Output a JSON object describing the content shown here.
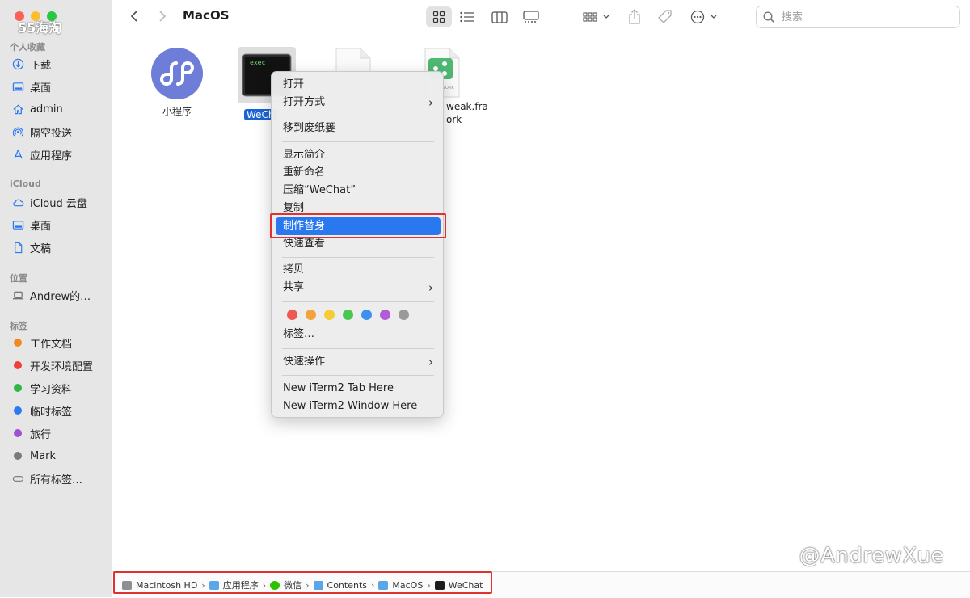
{
  "window": {
    "title": "MacOS"
  },
  "overlay": {
    "top_watermark": "55海淘",
    "bottom_watermark": "@AndrewXue"
  },
  "search": {
    "placeholder": "搜索",
    "value": ""
  },
  "sidebar": {
    "sections": [
      {
        "title": "个人收藏",
        "items": [
          {
            "label": "下载",
            "icon": "download-icon"
          },
          {
            "label": "桌面",
            "icon": "desktop-icon"
          },
          {
            "label": "admin",
            "icon": "home-icon"
          },
          {
            "label": "隔空投送",
            "icon": "airdrop-icon"
          },
          {
            "label": "应用程序",
            "icon": "applications-icon"
          }
        ]
      },
      {
        "title": "iCloud",
        "items": [
          {
            "label": "iCloud 云盘",
            "icon": "cloud-icon"
          },
          {
            "label": "桌面",
            "icon": "desktop-icon"
          },
          {
            "label": "文稿",
            "icon": "document-icon"
          }
        ]
      },
      {
        "title": "位置",
        "items": [
          {
            "label": "Andrew的…",
            "icon": "laptop-icon"
          }
        ]
      },
      {
        "title": "标签",
        "items": [
          {
            "label": "工作文档",
            "color": "#f08a1c"
          },
          {
            "label": "开发环境配置",
            "color": "#ee4038"
          },
          {
            "label": "学习资料",
            "color": "#2fb944"
          },
          {
            "label": "临时标签",
            "color": "#2a7bf0"
          },
          {
            "label": "旅行",
            "color": "#a24fd0"
          },
          {
            "label": "Mark",
            "color": "#7a7a7a"
          },
          {
            "label": "所有标签…",
            "icon": "all-tags-icon"
          }
        ]
      }
    ]
  },
  "files": [
    {
      "label": "小程序",
      "icon": "miniprogram-icon"
    },
    {
      "label": "WeCh",
      "icon": "terminal-exec-icon",
      "icon_text": "exec",
      "selected": true
    },
    {
      "label": "",
      "icon": "blank-file-icon"
    },
    {
      "label_line1": "weak.fra",
      "label_line2": "ork",
      "icon": "framework-icon",
      "icon_text": "WORK"
    }
  ],
  "context_menu": {
    "items": [
      {
        "label": "打开"
      },
      {
        "label": "打开方式",
        "submenu": true
      },
      {
        "label": "移到废纸篓"
      },
      {
        "label": "显示简介"
      },
      {
        "label": "重新命名"
      },
      {
        "label": "压缩“WeChat”"
      },
      {
        "label": "复制"
      },
      {
        "label": "制作替身",
        "highlighted": true
      },
      {
        "label": "快速查看"
      },
      {
        "label": "拷贝"
      },
      {
        "label": "共享",
        "submenu": true
      },
      {
        "label": "标签…"
      },
      {
        "label": "快速操作",
        "submenu": true
      },
      {
        "label": "New iTerm2 Tab Here"
      },
      {
        "label": "New iTerm2 Window Here"
      }
    ],
    "tag_colors": [
      "#ee5a52",
      "#f3a33b",
      "#f5cd33",
      "#4cc552",
      "#3f8ff0",
      "#b05ed8",
      "#9a9a9a"
    ],
    "submenu_glyph": "›"
  },
  "pathbar": {
    "crumbs": [
      {
        "label": "Macintosh HD",
        "icon": "disk-icon",
        "color": "#8e8e93"
      },
      {
        "label": "应用程序",
        "icon": "folder-icon",
        "color": "#5aa6e8"
      },
      {
        "label": "微信",
        "icon": "wechat-icon",
        "color": "#2dc100"
      },
      {
        "label": "Contents",
        "icon": "folder-icon",
        "color": "#5aa6e8"
      },
      {
        "label": "MacOS",
        "icon": "folder-icon",
        "color": "#5aa6e8"
      },
      {
        "label": "WeChat",
        "icon": "terminal-icon",
        "color": "#1d1d1d"
      }
    ],
    "separator": "›"
  }
}
